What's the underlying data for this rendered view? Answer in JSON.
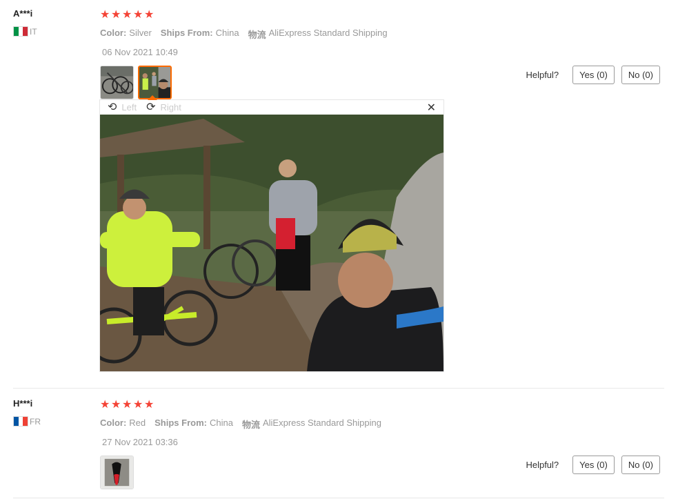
{
  "reviews": [
    {
      "user": "A***i",
      "country_code": "IT",
      "flag_colors": [
        "#009246",
        "#ffffff",
        "#ce2b37"
      ],
      "rating": 5,
      "color_label": "Color:",
      "color_value": "Silver",
      "ships_label": "Ships From:",
      "ships_value": "China",
      "shipping_label": "物流",
      "shipping_value": "AliExpress Standard Shipping",
      "date": "06 Nov 2021 10:49",
      "helpful_label": "Helpful?",
      "yes_label": "Yes (0)",
      "no_label": "No (0)"
    },
    {
      "user": "H***i",
      "country_code": "FR",
      "flag_colors": [
        "#0055a4",
        "#ffffff",
        "#ef4135"
      ],
      "rating": 5,
      "color_label": "Color:",
      "color_value": "Red",
      "ships_label": "Ships From:",
      "ships_value": "China",
      "shipping_label": "物流",
      "shipping_value": "AliExpress Standard Shipping",
      "date": "27 Nov 2021 03:36",
      "helpful_label": "Helpful?",
      "yes_label": "Yes (0)",
      "no_label": "No (0)"
    }
  ],
  "viewer": {
    "rotate_left_label": "Left",
    "rotate_right_label": "Right",
    "close_icon": "close-icon"
  },
  "colors": {
    "star": "#f44336",
    "active_thumb_border": "#ff6a00"
  }
}
